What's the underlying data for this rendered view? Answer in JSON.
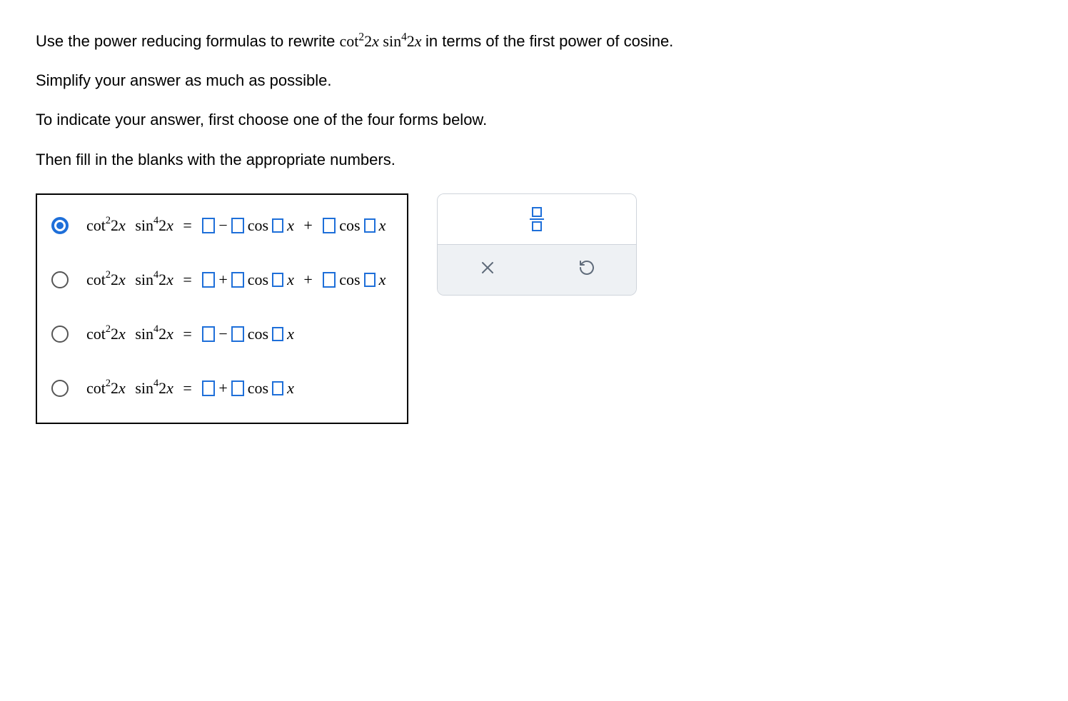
{
  "question": {
    "line1_pre": "Use the power reducing formulas to rewrite ",
    "expr_cot": "cot",
    "expr_sup2": "2",
    "expr_2x": "2",
    "expr_xi": "x",
    "expr_sin": "sin",
    "expr_sup4": "4",
    "line1_post": " in terms of the first power of cosine.",
    "line2": "Simplify your answer as much as possible.",
    "line3": "To indicate your answer, first choose one of the four forms below.",
    "line4": "Then fill in the blanks with the appropriate numbers."
  },
  "options": [
    {
      "selected": true,
      "op1": "−",
      "op2": "+",
      "terms": 3
    },
    {
      "selected": false,
      "op1": "+",
      "op2": "+",
      "terms": 3
    },
    {
      "selected": false,
      "op1": "−",
      "op2": "",
      "terms": 2
    },
    {
      "selected": false,
      "op1": "+",
      "op2": "",
      "terms": 2
    }
  ],
  "lhs": {
    "cot": "cot",
    "sup2": "2",
    "two": "2",
    "x": "x",
    "sin": "sin",
    "sup4": "4",
    "eq": "="
  },
  "cos_label": "cos",
  "x_label": "x",
  "tools": {
    "fraction": "fraction",
    "close": "close",
    "reset": "reset"
  }
}
